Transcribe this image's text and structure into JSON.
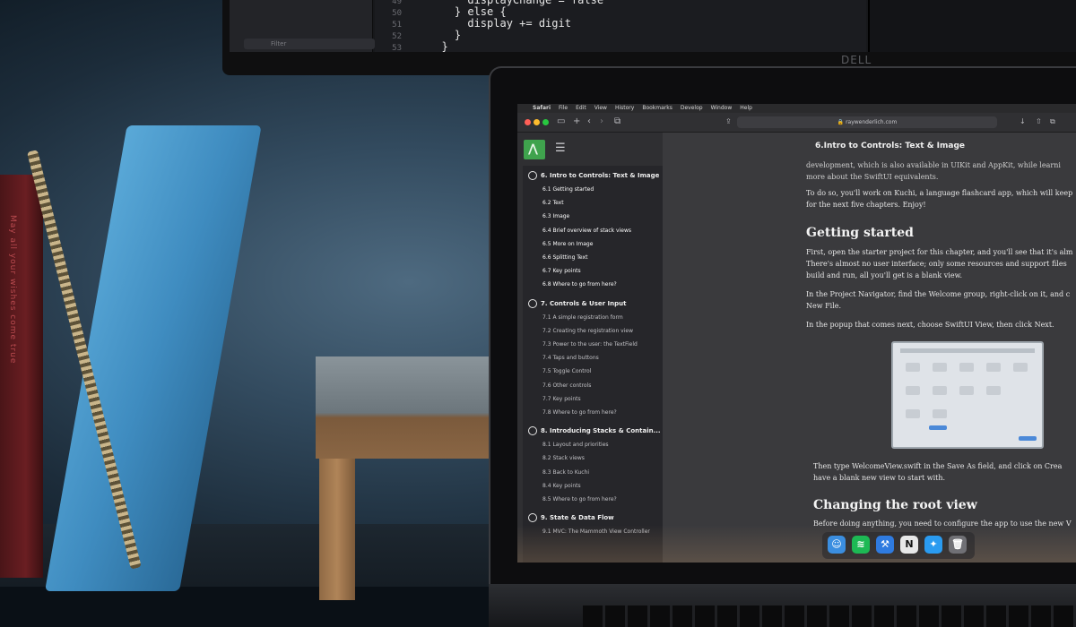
{
  "monitor": {
    "brand": "DELL",
    "filter_placeholder": "Filter",
    "code_lines": [
      {
        "num": "49",
        "text": "      displayChange = false"
      },
      {
        "num": "50",
        "text": "    } else {"
      },
      {
        "num": "51",
        "text": "      display += digit"
      },
      {
        "num": "52",
        "text": "    }"
      },
      {
        "num": "53",
        "text": "  }"
      }
    ]
  },
  "red_book": {
    "spine_text": "May all your wishes come true"
  },
  "menubar": {
    "items": [
      "Safari",
      "File",
      "Edit",
      "View",
      "History",
      "Bookmarks",
      "Develop",
      "Window",
      "Help"
    ]
  },
  "browser": {
    "url": "raywenderlich.com",
    "page_title": "6.Intro to Controls: Text & Image"
  },
  "toc": {
    "chapters": [
      {
        "label": "6. Intro to Controls: Text & Image",
        "items": [
          "6.1 Getting started",
          "6.2 Text",
          "6.3 Image",
          "6.4 Brief overview of stack views",
          "6.5 More on Image",
          "6.6 Splitting Text",
          "6.7 Key points",
          "6.8 Where to go from here?"
        ]
      },
      {
        "label": "7. Controls & User Input",
        "items": [
          "7.1 A simple registration form",
          "7.2 Creating the registration view",
          "7.3 Power to the user: the TextField",
          "7.4 Taps and buttons",
          "7.5 Toggle Control",
          "7.6 Other controls",
          "7.7 Key points",
          "7.8 Where to go from here?"
        ]
      },
      {
        "label": "8. Introducing Stacks & Contain...",
        "items": [
          "8.1 Layout and priorities",
          "8.2 Stack views",
          "8.3 Back to Kuchi",
          "8.4 Key points",
          "8.5 Where to go from here?"
        ]
      },
      {
        "label": "9. State & Data Flow",
        "items": [
          "9.1 MVC: The Mammoth View Controller"
        ]
      }
    ]
  },
  "content": {
    "intro_lines": [
      "development, which is also available in UIKit and AppKit, while learni",
      "more about the SwiftUI equivalents."
    ],
    "kuchi_lines": [
      "To do so, you'll work on Kuchi, a language flashcard app, which will keep",
      "for the next five chapters. Enjoy!"
    ],
    "h_getting_started": "Getting started",
    "gs_lines": [
      "First, open the starter project for this chapter, and you'll see that it's alm",
      "There's almost no user interface; only some resources and support files",
      "build and run, all you'll get is a blank view."
    ],
    "navigator_lines": [
      "In the Project Navigator, find the Welcome group, right-click on it, and c",
      "New File."
    ],
    "popup_line": "In the popup that comes next, choose SwiftUI View, then click Next.",
    "then_lines": [
      "Then type WelcomeView.swift in the Save As field, and click on Crea",
      "have a blank new view to start with."
    ],
    "h_root_view": "Changing the root view",
    "root_line": "Before doing anything, you need to configure the app to use the new V"
  },
  "dock": {
    "apps": [
      {
        "name": "finder-icon",
        "glyph": "☺",
        "color": "#3b8ee0"
      },
      {
        "name": "spotify-icon",
        "glyph": "≋",
        "color": "#1db954"
      },
      {
        "name": "xcode-icon",
        "glyph": "⚒",
        "color": "#2f7be0"
      },
      {
        "name": "notion-icon",
        "glyph": "N",
        "color": "#e8e8e8"
      },
      {
        "name": "safari-icon",
        "glyph": "✦",
        "color": "#2a9bf0"
      },
      {
        "name": "trash-icon",
        "glyph": "🗑",
        "color": "#707075"
      }
    ]
  },
  "colors": {
    "accent_green": "#3fa34d",
    "traffic_red": "#ff5f57",
    "traffic_yellow": "#febc2e",
    "traffic_green": "#28c840"
  }
}
